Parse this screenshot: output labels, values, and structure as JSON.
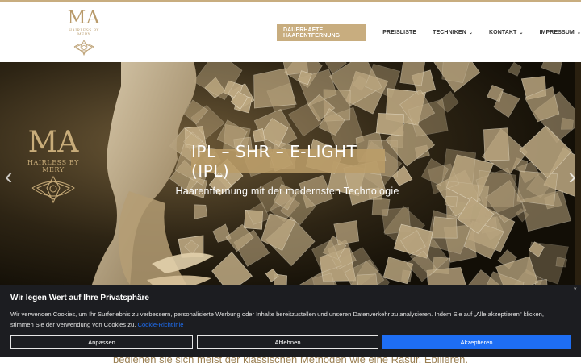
{
  "brand": {
    "monogram": "MA",
    "tagline": "HAIRLESS BY MERY"
  },
  "nav": [
    {
      "label": "DAUERHAFTE HAARENTFERNUNG",
      "has_menu": false,
      "active": true
    },
    {
      "label": "PREISLISTE",
      "has_menu": false,
      "active": false
    },
    {
      "label": "TECHNIKEN",
      "has_menu": true,
      "active": false
    },
    {
      "label": "KONTAKT",
      "has_menu": true,
      "active": false
    },
    {
      "label": "IMPRESSUM",
      "has_menu": true,
      "active": false
    }
  ],
  "hero": {
    "title": "IPL – SHR – E-LIGHT (IPL)",
    "subtitle": "Haarentfernung mit der modernsten Technologie",
    "prev_icon": "‹",
    "next_icon": "›"
  },
  "behind_text": "bedienen sie sich meist der klassischen Methoden wie eine Rasur, Epilieren,",
  "cookie": {
    "title": "Wir legen Wert auf Ihre Privatsphäre",
    "text": "Wir verwenden Cookies, um Ihr Surferlebnis zu verbessern, personalisierte Werbung oder Inhalte bereitzustellen und unseren Datenverkehr zu analysieren. Indem Sie auf „Alle akzeptieren\" klicken, stimmen Sie der Verwendung von Cookies zu.",
    "link": "Cookie-Richtlinie",
    "close_icon": "×",
    "buttons": {
      "customize": "Anpassen",
      "reject": "Ablehnen",
      "accept": "Akzeptieren"
    }
  },
  "colors": {
    "accent": "#c8ad7f",
    "cookie_bg": "#1c1d21",
    "primary_button": "#1e6ef4"
  }
}
